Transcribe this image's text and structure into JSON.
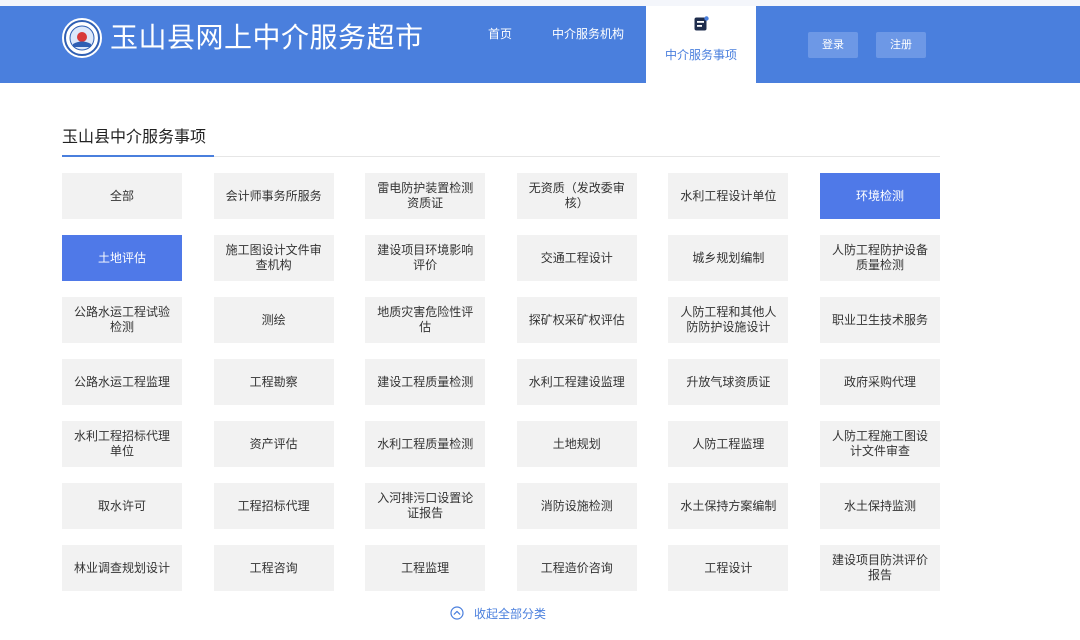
{
  "header": {
    "site_title": "玉山县网上中介服务超市",
    "logo_icon": "county-seal-logo",
    "nav": {
      "home": "首页",
      "agencies": "中介服务机构",
      "items": "中介服务事项",
      "items_icon": "document-list-icon"
    },
    "login": "登录",
    "register": "注册"
  },
  "section": {
    "title": "玉山县中介服务事项"
  },
  "categories": [
    {
      "label": "全部",
      "active": false
    },
    {
      "label": "会计师事务所服务",
      "active": false
    },
    {
      "label": "雷电防护装置检测资质证",
      "active": false
    },
    {
      "label": "无资质（发改委审核）",
      "active": false
    },
    {
      "label": "水利工程设计单位",
      "active": false
    },
    {
      "label": "环境检测",
      "active": true
    },
    {
      "label": "土地评估",
      "active": true
    },
    {
      "label": "施工图设计文件审查机构",
      "active": false
    },
    {
      "label": "建设项目环境影响评价",
      "active": false
    },
    {
      "label": "交通工程设计",
      "active": false
    },
    {
      "label": "城乡规划编制",
      "active": false
    },
    {
      "label": "人防工程防护设备质量检测",
      "active": false
    },
    {
      "label": "公路水运工程试验检测",
      "active": false
    },
    {
      "label": "测绘",
      "active": false
    },
    {
      "label": "地质灾害危险性评估",
      "active": false
    },
    {
      "label": "探矿权采矿权评估",
      "active": false
    },
    {
      "label": "人防工程和其他人防防护设施设计",
      "active": false
    },
    {
      "label": "职业卫生技术服务",
      "active": false
    },
    {
      "label": "公路水运工程监理",
      "active": false
    },
    {
      "label": "工程勘察",
      "active": false
    },
    {
      "label": "建设工程质量检测",
      "active": false
    },
    {
      "label": "水利工程建设监理",
      "active": false
    },
    {
      "label": "升放气球资质证",
      "active": false
    },
    {
      "label": "政府采购代理",
      "active": false
    },
    {
      "label": "水利工程招标代理单位",
      "active": false
    },
    {
      "label": "资产评估",
      "active": false
    },
    {
      "label": "水利工程质量检测",
      "active": false
    },
    {
      "label": "土地规划",
      "active": false
    },
    {
      "label": "人防工程监理",
      "active": false
    },
    {
      "label": "人防工程施工图设计文件审查",
      "active": false
    },
    {
      "label": "取水许可",
      "active": false
    },
    {
      "label": "工程招标代理",
      "active": false
    },
    {
      "label": "入河排污口设置论证报告",
      "active": false
    },
    {
      "label": "消防设施检测",
      "active": false
    },
    {
      "label": "水土保持方案编制",
      "active": false
    },
    {
      "label": "水土保持监测",
      "active": false
    },
    {
      "label": "林业调查规划设计",
      "active": false
    },
    {
      "label": "工程咨询",
      "active": false
    },
    {
      "label": "工程监理",
      "active": false
    },
    {
      "label": "工程造价咨询",
      "active": false
    },
    {
      "label": "工程设计",
      "active": false
    },
    {
      "label": "建设项目防洪评价报告",
      "active": false
    }
  ],
  "collapse": {
    "label": "收起全部分类",
    "icon": "chevron-up-circle-icon"
  },
  "colors": {
    "brand": "#4a7fdd",
    "active_tile": "#4f79e8",
    "tile": "#f2f2f2"
  }
}
